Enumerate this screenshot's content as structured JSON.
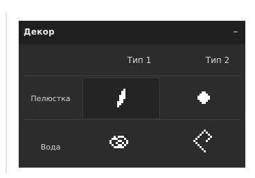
{
  "panel": {
    "title": "Декор",
    "collapse_glyph": "–"
  },
  "columns": [
    "Тип 1",
    "Тип 2"
  ],
  "rows": [
    {
      "label": "Пелюстка",
      "cells": [
        {
          "icon": "petal-type1-icon",
          "selected": true
        },
        {
          "icon": "petal-type2-icon",
          "selected": false
        }
      ]
    },
    {
      "label": "Вода",
      "cells": [
        {
          "icon": "water-type1-icon",
          "selected": false
        },
        {
          "icon": "water-type2-icon",
          "selected": false
        }
      ]
    }
  ],
  "colors": {
    "panel_bg": "#2c2c2c",
    "header_bg": "#1f1f1f",
    "icon": "#ffffff",
    "text": "#d8d8d8"
  }
}
